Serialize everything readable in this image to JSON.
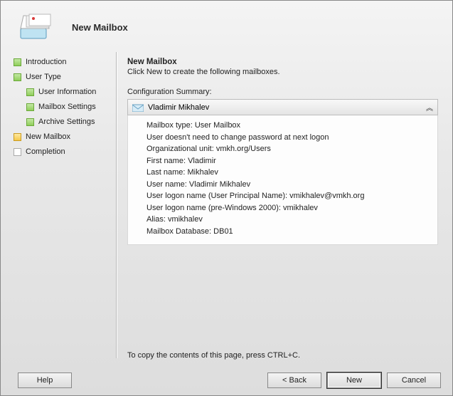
{
  "header": {
    "title": "New Mailbox"
  },
  "sidebar": {
    "steps": [
      {
        "label": "Introduction"
      },
      {
        "label": "User Type"
      },
      {
        "label": "User Information"
      },
      {
        "label": "Mailbox Settings"
      },
      {
        "label": "Archive Settings"
      },
      {
        "label": "New Mailbox"
      },
      {
        "label": "Completion"
      }
    ]
  },
  "main": {
    "title": "New Mailbox",
    "subtitle": "Click New to create the following mailboxes.",
    "config_label": "Configuration Summary:",
    "summary_name": "Vladimir Mikhalev",
    "lines": {
      "l0": "Mailbox type: User Mailbox",
      "l1": "User doesn't need to change password at next logon",
      "l2": "Organizational unit: vmkh.org/Users",
      "l3": "First name: Vladimir",
      "l4": "Last name: Mikhalev",
      "l5": "User name: Vladimir Mikhalev",
      "l6": "User logon name (User Principal Name): vmikhalev@vmkh.org",
      "l7": "User logon name (pre-Windows 2000): vmikhalev",
      "l8": "Alias: vmikhalev",
      "l9": "Mailbox Database: DB01"
    },
    "copy_hint": "To copy the contents of this page, press CTRL+C."
  },
  "footer": {
    "help": "Help",
    "back": "< Back",
    "new": "New",
    "cancel": "Cancel"
  }
}
